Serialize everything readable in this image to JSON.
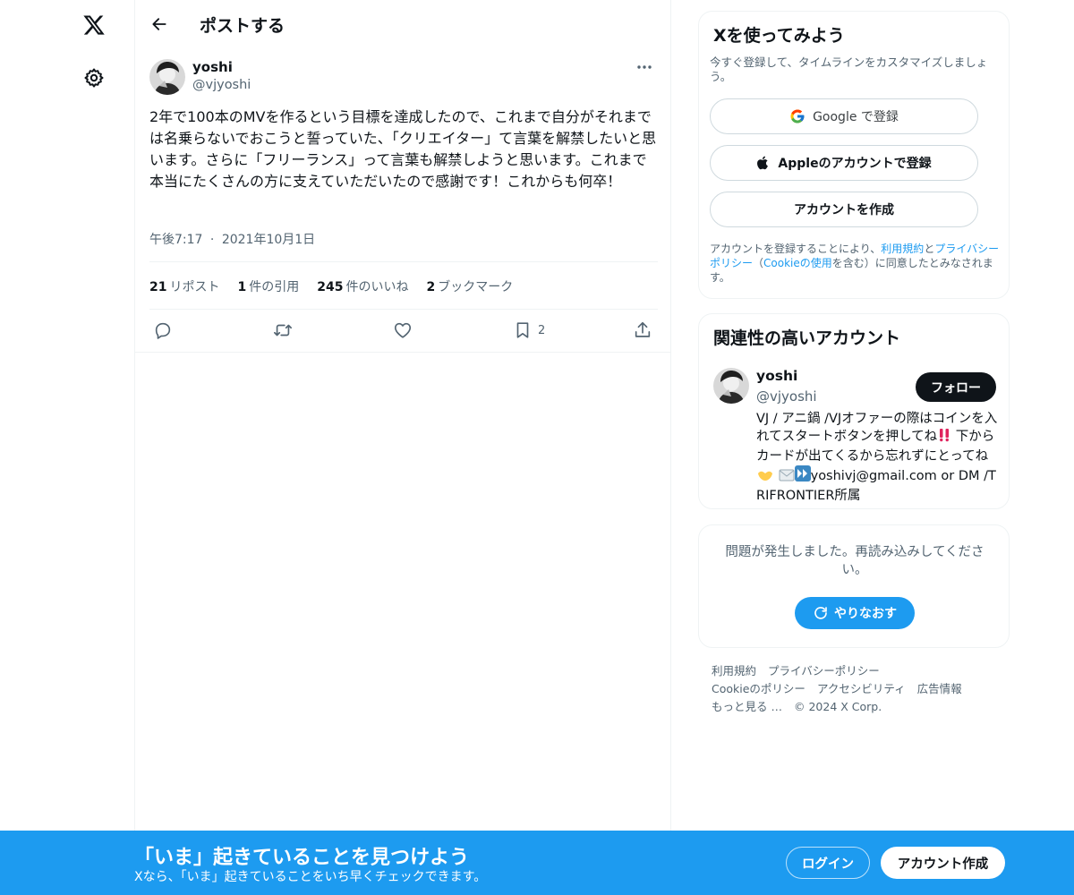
{
  "header": {
    "title": "ポストする"
  },
  "post": {
    "author_name": "yoshi",
    "author_handle": "@vjyoshi",
    "text": "2年で100本のMVを作るという目標を達成したので、これまで自分がそれまでは名乗らないでおこうと誓っていた、「クリエイター」て言葉を解禁したいと思います。さらに「フリーランス」って言葉も解禁しようと思います。これまで本当にたくさんの方に支えていただいたので感謝です！これからも何卒！",
    "time": "午後7:17",
    "separator": "·",
    "date": "2021年10月1日",
    "stats": [
      {
        "count": "21",
        "label": "リポスト"
      },
      {
        "count": "1",
        "label": "件の引用"
      },
      {
        "count": "245",
        "label": "件のいいね"
      },
      {
        "count": "2",
        "label": "ブックマーク"
      }
    ],
    "bookmark_count": "2"
  },
  "signup": {
    "title": "Xを使ってみよう",
    "subtitle": "今すぐ登録して、タイムラインをカスタマイズしましょう。",
    "google_label": "Google で登録",
    "apple_label": "Appleのアカウントで登録",
    "create_label": "アカウントを作成",
    "terms_prefix": "アカウントを登録することにより、",
    "terms_link": "利用規約",
    "terms_and": "と",
    "privacy_link": "プライバシーポリシー",
    "terms_open": "（",
    "cookie_link": "Cookieの使用",
    "terms_suffix": "を含む）に同意したとみなされます。"
  },
  "related": {
    "title": "関連性の高いアカウント",
    "name": "yoshi",
    "handle": "@vjyoshi",
    "follow_label": "フォロー",
    "bio_part1": "VJ / アニ鍋 /VJオファーの際はコインを入れてスタートボタンを押してね",
    "bio_part2": " 下からカードが出てくるから忘れずにとってね",
    "bio_part3": "yoshivj@gmail.com or DM /TRIFRONTIER所属"
  },
  "error": {
    "message": "問題が発生しました。再読み込みしてください。",
    "retry_label": "やりなおす"
  },
  "footer": {
    "terms": "利用規約",
    "privacy": "プライバシーポリシー",
    "cookie": "Cookieのポリシー",
    "accessibility": "アクセシビリティ",
    "ads": "広告情報",
    "more": "もっと見る …",
    "copyright": "© 2024 X Corp."
  },
  "banner": {
    "title": "「いま」起きていることを見つけよう",
    "subtitle": "Xなら、「いま」起きていることをいち早くチェックできます。",
    "login_label": "ログイン",
    "register_label": "アカウント作成"
  },
  "colors": {
    "accent": "#1d9bf0",
    "text": "#0f1419",
    "secondary": "#536471",
    "border": "#eff3f4"
  },
  "icons": [
    "x-logo-icon",
    "gear-icon",
    "back-arrow-icon",
    "more-icon",
    "reply-icon",
    "repost-icon",
    "like-icon",
    "bookmark-icon",
    "share-icon",
    "google-icon",
    "apple-icon",
    "refresh-icon"
  ]
}
